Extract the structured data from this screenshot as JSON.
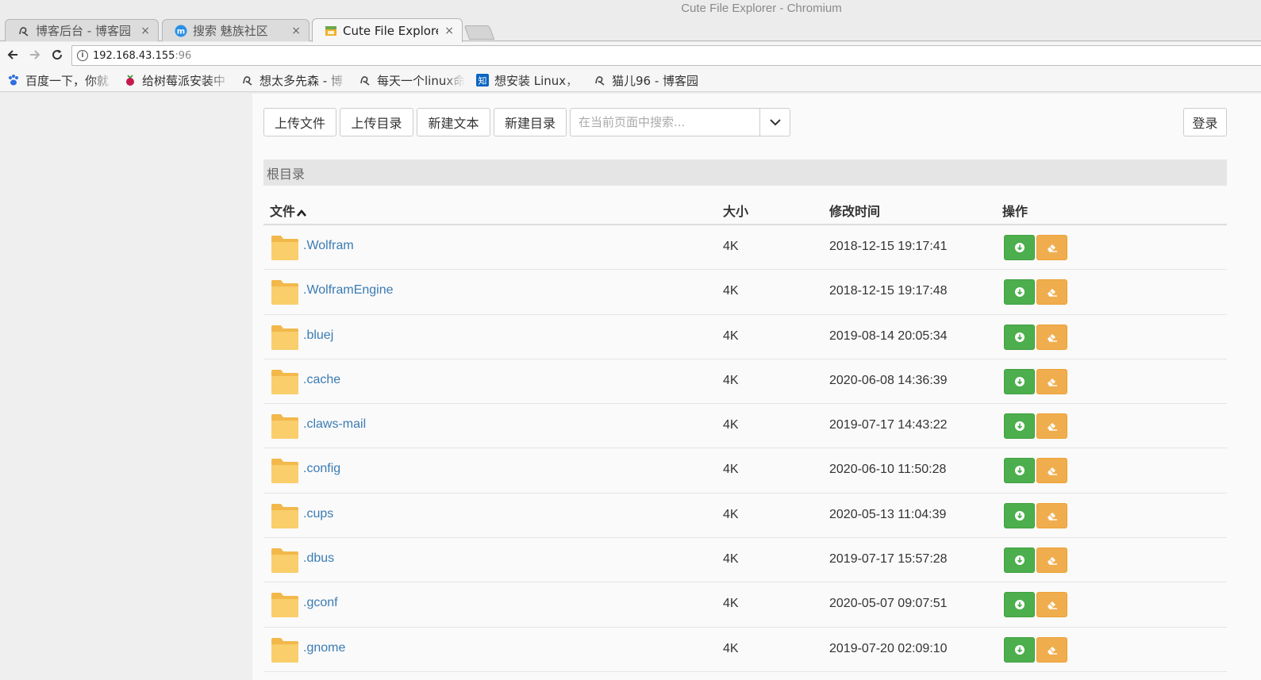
{
  "window": {
    "title": "Cute File Explorer - Chromium"
  },
  "tabs": [
    {
      "label": "博客后台 - 博客园",
      "icon": "cnblogs-icon",
      "active": false
    },
    {
      "label": "搜索 魅族社区",
      "icon": "meizu-icon",
      "active": false
    },
    {
      "label": "Cute File Explorer",
      "icon": "file-explorer-icon",
      "active": true
    }
  ],
  "tab_close": "×",
  "address": {
    "host": "192.168.43.155",
    "port": ":96"
  },
  "bookmarks": [
    {
      "label": "百度一下，你就",
      "icon": "baidu-paw-icon"
    },
    {
      "label": "给树莓派安装中",
      "icon": "raspberry-icon"
    },
    {
      "label": "想太多先森 - 博",
      "icon": "cnblogs-icon"
    },
    {
      "label": "每天一个linux命",
      "icon": "cnblogs-icon"
    },
    {
      "label": "想安装 Linux，",
      "icon": "zhihu-icon"
    },
    {
      "label": "猫儿96 - 博客园",
      "icon": "cnblogs-icon"
    }
  ],
  "actions": {
    "upload_file": "上传文件",
    "upload_dir": "上传目录",
    "new_text": "新建文本",
    "new_dir": "新建目录",
    "login": "登录"
  },
  "search": {
    "placeholder": "在当前页面中搜索..."
  },
  "breadcrumb": "根目录",
  "table": {
    "headers": {
      "name": "文件",
      "size": "大小",
      "mtime": "修改时间",
      "ops": "操作"
    },
    "rows": [
      {
        "name": ".Wolfram",
        "size": "4K",
        "mtime": "2018-12-15 19:17:41"
      },
      {
        "name": ".WolframEngine",
        "size": "4K",
        "mtime": "2018-12-15 19:17:48"
      },
      {
        "name": ".bluej",
        "size": "4K",
        "mtime": "2019-08-14 20:05:34"
      },
      {
        "name": ".cache",
        "size": "4K",
        "mtime": "2020-06-08 14:36:39"
      },
      {
        "name": ".claws-mail",
        "size": "4K",
        "mtime": "2019-07-17 14:43:22"
      },
      {
        "name": ".config",
        "size": "4K",
        "mtime": "2020-06-10 11:50:28"
      },
      {
        "name": ".cups",
        "size": "4K",
        "mtime": "2020-05-13 11:04:39"
      },
      {
        "name": ".dbus",
        "size": "4K",
        "mtime": "2019-07-17 15:57:28"
      },
      {
        "name": ".gconf",
        "size": "4K",
        "mtime": "2020-05-07 09:07:51"
      },
      {
        "name": ".gnome",
        "size": "4K",
        "mtime": "2019-07-20 02:09:10"
      }
    ]
  },
  "colors": {
    "link": "#3a7bb3",
    "download_button": "#4cae4c",
    "edit_button": "#f0ad4e",
    "folder": "#f7c964"
  }
}
